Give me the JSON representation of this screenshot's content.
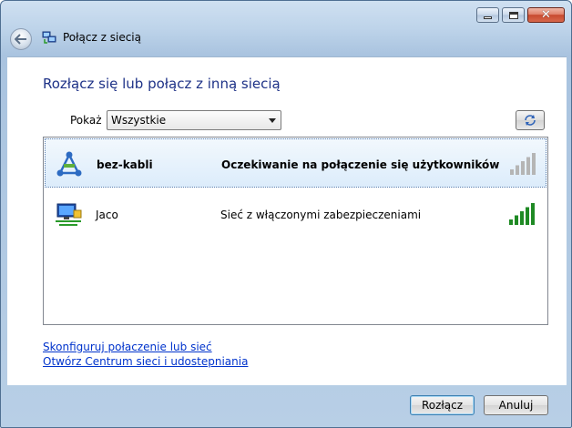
{
  "window": {
    "title": "Połącz z siecią",
    "minimize_icon": "minimize-icon",
    "maximize_icon": "maximize-icon",
    "close_glyph": "✕"
  },
  "main": {
    "heading": "Rozłącz się lub połącz z inną siecią",
    "show_label": "Pokaż",
    "filter_value": "Wszystkie",
    "refresh_icon": "refresh-icon"
  },
  "networks": [
    {
      "name": "bez-kabli",
      "status": "Oczekiwanie na połączenie się użytkowników",
      "icon": "adhoc-network-icon",
      "signal_bars": 0,
      "selected": true
    },
    {
      "name": "Jaco",
      "status": "Sieć z włączonymi zabezpieczeniami",
      "icon": "secure-network-icon",
      "signal_bars": 5,
      "selected": false
    }
  ],
  "links": {
    "setup": "Skonfiguruj połaczenie lub sieć",
    "center": "Otwórz Centrum sieci i udostepniania"
  },
  "buttons": {
    "disconnect": "Rozłącz",
    "cancel": "Anuluj"
  },
  "colors": {
    "heading": "#1e3287",
    "link": "#0033cc",
    "signal_on": "#1f8a24",
    "signal_off": "#b5b5b5"
  }
}
